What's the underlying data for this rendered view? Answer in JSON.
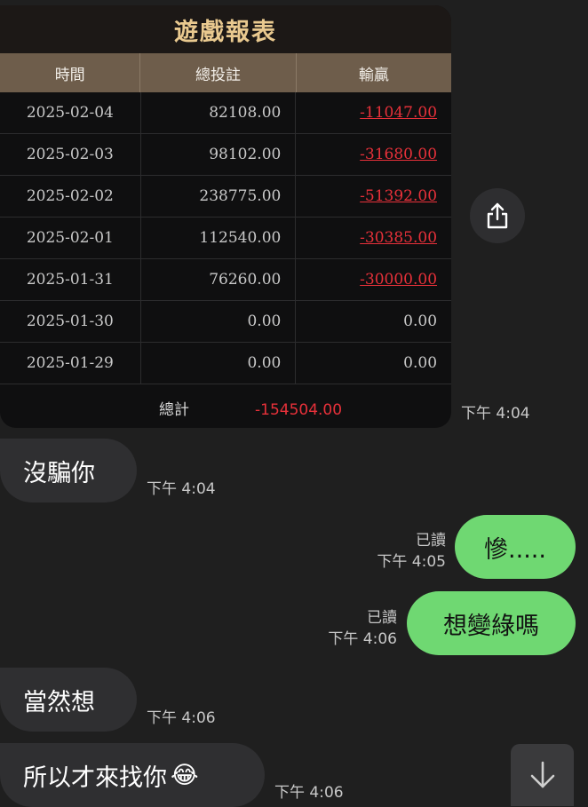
{
  "report": {
    "title": "遊戲報表",
    "columns": [
      "時間",
      "總投註",
      "輸贏"
    ],
    "rows": [
      {
        "date": "2025-02-04",
        "bet": "82108.00",
        "result": "-11047.00"
      },
      {
        "date": "2025-02-03",
        "bet": "98102.00",
        "result": "-31680.00"
      },
      {
        "date": "2025-02-02",
        "bet": "238775.00",
        "result": "-51392.00"
      },
      {
        "date": "2025-02-01",
        "bet": "112540.00",
        "result": "-30385.00"
      },
      {
        "date": "2025-01-31",
        "bet": "76260.00",
        "result": "-30000.00"
      },
      {
        "date": "2025-01-30",
        "bet": "0.00",
        "result": "0.00"
      },
      {
        "date": "2025-01-29",
        "bet": "0.00",
        "result": "0.00"
      }
    ],
    "total_label": "總計",
    "total_value": "-154504.00",
    "time": "下午 4:04"
  },
  "messages": [
    {
      "side": "in",
      "text": "沒騙你",
      "time": "下午 4:04"
    },
    {
      "side": "out",
      "text": "慘.....",
      "read": "已讀",
      "time": "下午 4:05"
    },
    {
      "side": "out",
      "text": "想變綠嗎",
      "read": "已讀",
      "time": "下午 4:06"
    },
    {
      "side": "in",
      "text": "當然想",
      "time": "下午 4:06"
    },
    {
      "side": "in",
      "text": "所以才來找你",
      "emoji": "😂",
      "time": "下午 4:06"
    }
  ],
  "icons": {
    "share": "share-icon",
    "scroll": "arrow-down-icon",
    "emoji": "tears-of-joy-emoji"
  },
  "colors": {
    "outgoing_bubble": "#6fd872",
    "incoming_bubble": "#2f2f31",
    "negative": "#e8313a",
    "header_bar": "#6e5d4b",
    "title_gold": "#e9c98f"
  }
}
